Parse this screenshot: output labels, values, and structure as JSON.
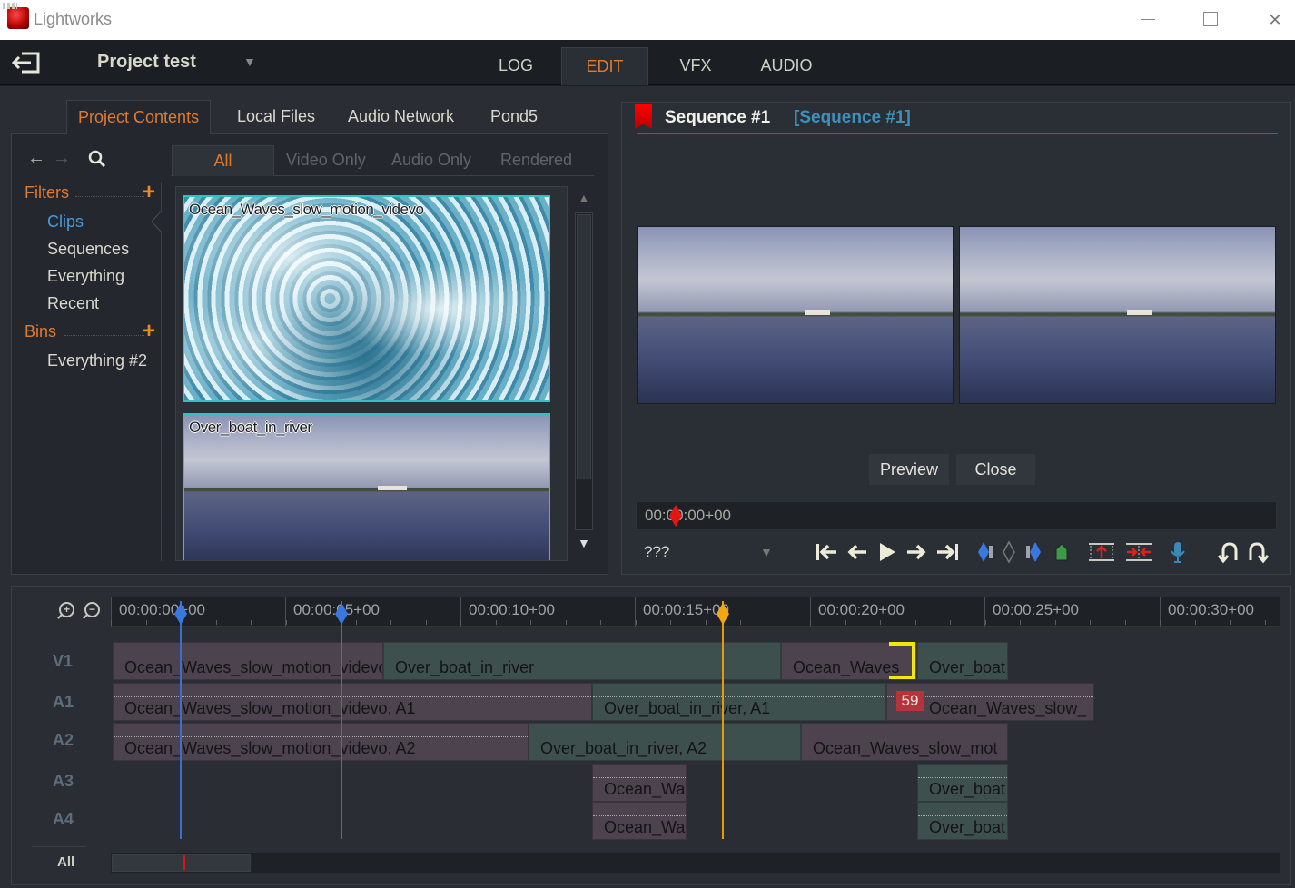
{
  "window": {
    "title": "Lightworks",
    "controls": {
      "minimize": "—",
      "maximize": "☐",
      "close": "✕"
    }
  },
  "topbar": {
    "exit_icon": "exit-icon",
    "project_title": "Project test",
    "project_dropdown": "▼",
    "mode_tabs": [
      {
        "label": "LOG",
        "active": false
      },
      {
        "label": "EDIT",
        "active": true
      },
      {
        "label": "VFX",
        "active": false
      },
      {
        "label": "AUDIO",
        "active": false
      }
    ]
  },
  "source_panel": {
    "tabs": [
      {
        "label": "Project Contents",
        "active": true
      },
      {
        "label": "Local Files",
        "active": false
      },
      {
        "label": "Audio Network",
        "active": false
      },
      {
        "label": "Pond5",
        "active": false
      }
    ],
    "nav": {
      "back": "←",
      "forward": "→",
      "search": "🔍",
      "keyboard": "keyboard-icon"
    },
    "filters": {
      "heading": "Filters",
      "add": "+",
      "items": [
        {
          "label": "Clips",
          "active": true
        },
        {
          "label": "Sequences",
          "active": false
        },
        {
          "label": "Everything",
          "active": false
        },
        {
          "label": "Recent",
          "active": false
        }
      ]
    },
    "bins": {
      "heading": "Bins",
      "add": "+",
      "items": [
        {
          "label": "Everything #2"
        }
      ]
    },
    "bin_tabs": [
      {
        "label": "All",
        "active": true
      },
      {
        "label": "Video Only",
        "active": false
      },
      {
        "label": "Audio Only",
        "active": false
      },
      {
        "label": "Rendered",
        "active": false
      }
    ],
    "clips": [
      {
        "name": "Ocean_Waves_slow_motion_videvo"
      },
      {
        "name": "Over_boat_in_river"
      }
    ],
    "scroll": {
      "up": "▲",
      "down": "▼"
    }
  },
  "viewer": {
    "title": "Sequence #1",
    "subtitle": "[Sequence #1]",
    "buttons": {
      "preview": "Preview",
      "close": "Close"
    },
    "timecode": "00:00:00+00",
    "mode_select": "???",
    "mode_arrow": "▼",
    "transport": [
      {
        "name": "go-to-start",
        "glyph": "⇤"
      },
      {
        "name": "step-back",
        "glyph": "🡐"
      },
      {
        "name": "play",
        "glyph": "▶"
      },
      {
        "name": "step-forward",
        "glyph": "🡒"
      },
      {
        "name": "go-to-end",
        "glyph": "⇥"
      }
    ],
    "colors": {
      "accent_red": "#b43a3a",
      "subtitle_blue": "#3f8fb8"
    }
  },
  "timeline": {
    "ruler_labels": [
      "00:00:00+00",
      "00:00:05+00",
      "00:00:10+00",
      "00:00:15+00",
      "00:00:20+00",
      "00:00:25+00",
      "00:00:30+00"
    ],
    "tracks": [
      "V1",
      "A1",
      "A2",
      "A3",
      "A4"
    ],
    "clips": {
      "v1": [
        "Ocean_Waves_slow_motion_videvo",
        "Over_boat_in_river",
        "Ocean_Waves",
        "Over_boat"
      ],
      "a1": [
        "Ocean_Waves_slow_motion_videvo, A1",
        "Over_boat_in_river, A1",
        "Ocean_Waves_slow_"
      ],
      "a2": [
        "Ocean_Waves_slow_motion_videvo, A2",
        "Over_boat_in_river, A2",
        "Ocean_Waves_slow_mot"
      ],
      "a3": [
        "Ocean_Wa",
        "Over_boat"
      ],
      "a4": [
        "Ocean_Wa",
        "Over_boat"
      ]
    },
    "frame_badge": "59",
    "all_label": "All",
    "colors": {
      "playhead": "#f5a614",
      "mark": "#3a78e0",
      "trim": "#f3e80c"
    }
  }
}
